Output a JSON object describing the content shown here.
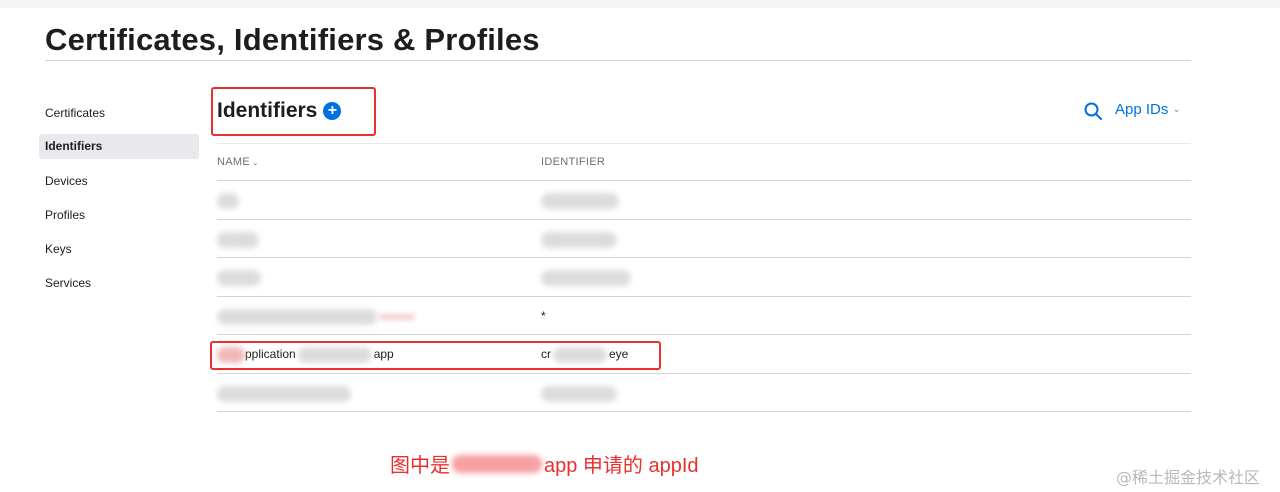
{
  "page": {
    "title": "Certificates, Identifiers & Profiles"
  },
  "sidebar": {
    "items": [
      {
        "label": "Certificates",
        "active": false
      },
      {
        "label": "Identifiers",
        "active": true
      },
      {
        "label": "Devices",
        "active": false
      },
      {
        "label": "Profiles",
        "active": false
      },
      {
        "label": "Keys",
        "active": false
      },
      {
        "label": "Services",
        "active": false
      }
    ]
  },
  "section": {
    "title": "Identifiers",
    "add_icon": "plus-circle-icon",
    "search_icon": "search-icon",
    "filter_label": "App IDs"
  },
  "table": {
    "columns": [
      "NAME",
      "IDENTIFIER"
    ],
    "rows": [
      {
        "name": "",
        "identifier": ""
      },
      {
        "name": "",
        "identifier": ""
      },
      {
        "name": "",
        "identifier": ""
      },
      {
        "name": "",
        "identifier": "*"
      },
      {
        "name_prefix": "pplication",
        "name_suffix": "app",
        "identifier_prefix": "cr",
        "identifier_suffix": "eye"
      },
      {
        "name": "",
        "identifier": ""
      }
    ]
  },
  "annotation": {
    "caption_prefix": "图中是",
    "caption_suffix": "app 申请的 appId"
  },
  "watermark": "@稀土掘金技术社区",
  "colors": {
    "accent": "#0071e3",
    "highlight": "#e8312f"
  }
}
